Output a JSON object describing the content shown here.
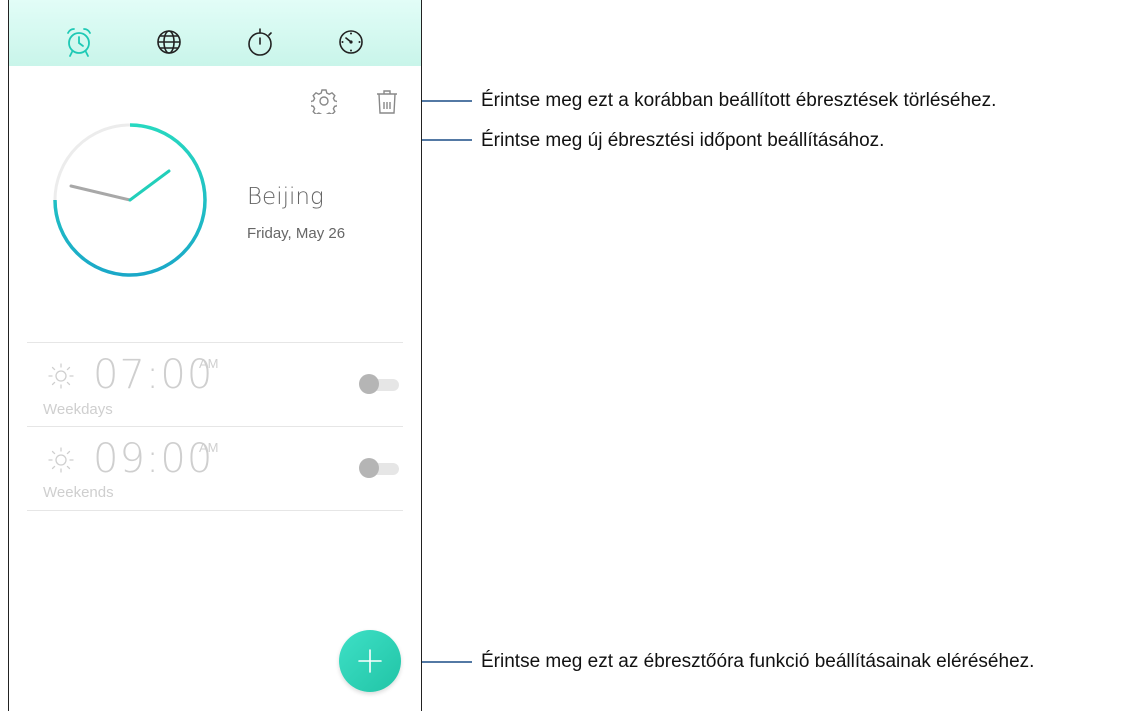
{
  "tabs": [
    {
      "name": "alarm-icon",
      "active": true
    },
    {
      "name": "world-clock-icon",
      "active": false
    },
    {
      "name": "stopwatch-icon",
      "active": false
    },
    {
      "name": "timer-icon",
      "active": false
    }
  ],
  "colors": {
    "accent": "#1ec9b5",
    "accent_dark": "#19a8c4",
    "inactive": "#cfcfcf",
    "topbar": "#d3f8ee"
  },
  "world_clock": {
    "city": "Beijing",
    "date": "Friday, May 26"
  },
  "alarms": [
    {
      "time": "07:00",
      "ampm": "AM",
      "repeat": "Weekdays",
      "enabled": false
    },
    {
      "time": "09:00",
      "ampm": "AM",
      "repeat": "Weekends",
      "enabled": false
    }
  ],
  "callouts": {
    "delete": "Érintse meg ezt a korábban beállított ébresztések törléséhez.",
    "settings": "Érintse meg új ébresztési időpont beállításához.",
    "add": "Érintse meg ezt az ébresztőóra funkció beállításainak eléréséhez."
  }
}
